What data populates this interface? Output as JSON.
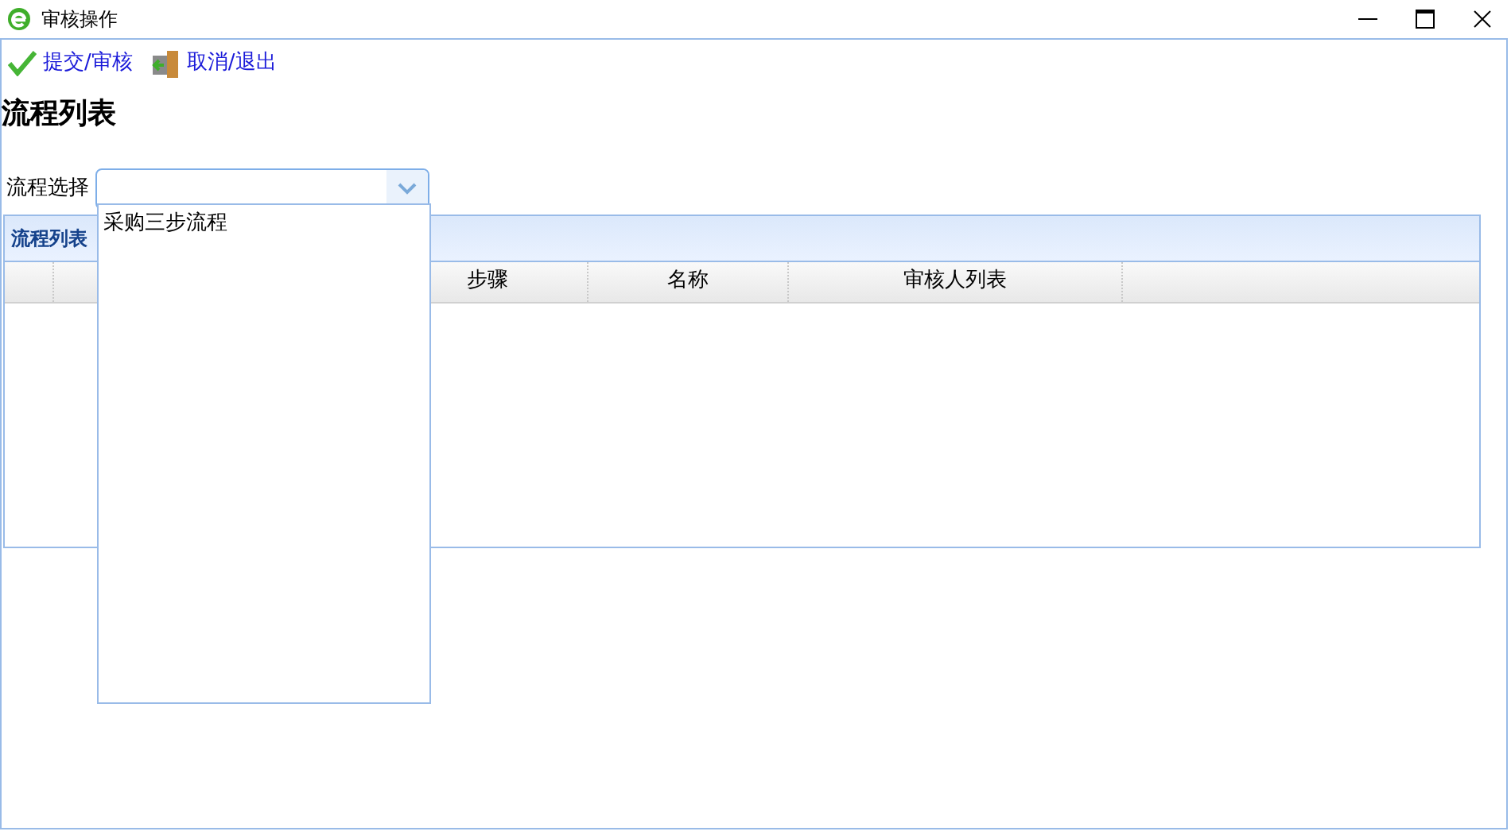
{
  "window": {
    "title": "审核操作"
  },
  "toolbar": [
    {
      "kind": "check",
      "label": "提交/审核"
    },
    {
      "kind": "exit",
      "label": "取消/退出"
    }
  ],
  "heading": "流程列表",
  "selector": {
    "label": "流程选择",
    "expanded": true,
    "options": [
      {
        "label": "采购三步流程"
      }
    ]
  },
  "panel": {
    "title": "流程列表",
    "columns": [
      "步骤",
      "名称",
      "审核人列表"
    ]
  }
}
